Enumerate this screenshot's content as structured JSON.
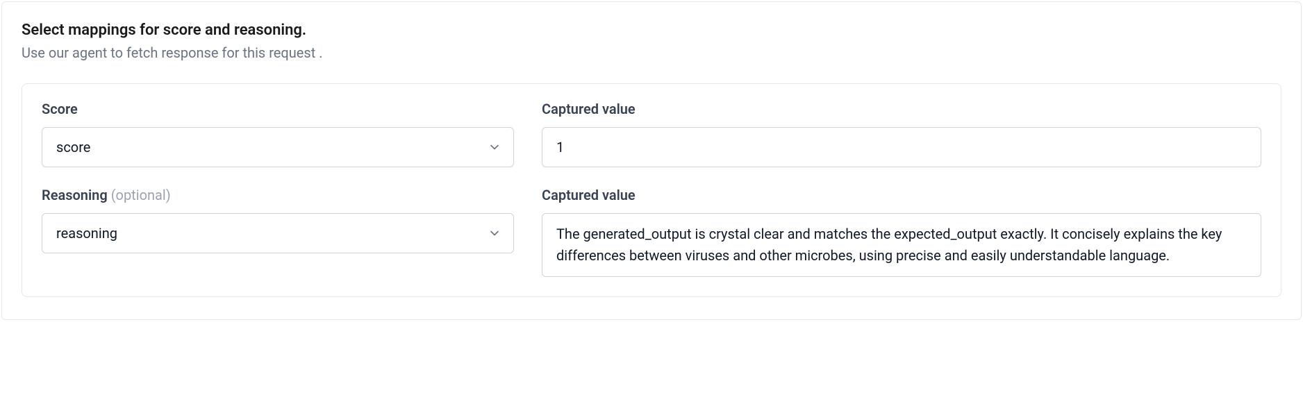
{
  "header": {
    "title": "Select mappings for score and reasoning.",
    "subtitle": "Use our agent to fetch response for this request ."
  },
  "fields": {
    "score": {
      "label": "Score",
      "selected": "score",
      "captured_label": "Captured value",
      "captured_value": "1"
    },
    "reasoning": {
      "label": "Reasoning ",
      "optional_suffix": "(optional)",
      "selected": "reasoning",
      "captured_label": "Captured value",
      "captured_value": "The generated_output is crystal clear and matches the expected_output exactly. It concisely explains the key differences between viruses and other microbes, using precise and easily understandable language."
    }
  }
}
